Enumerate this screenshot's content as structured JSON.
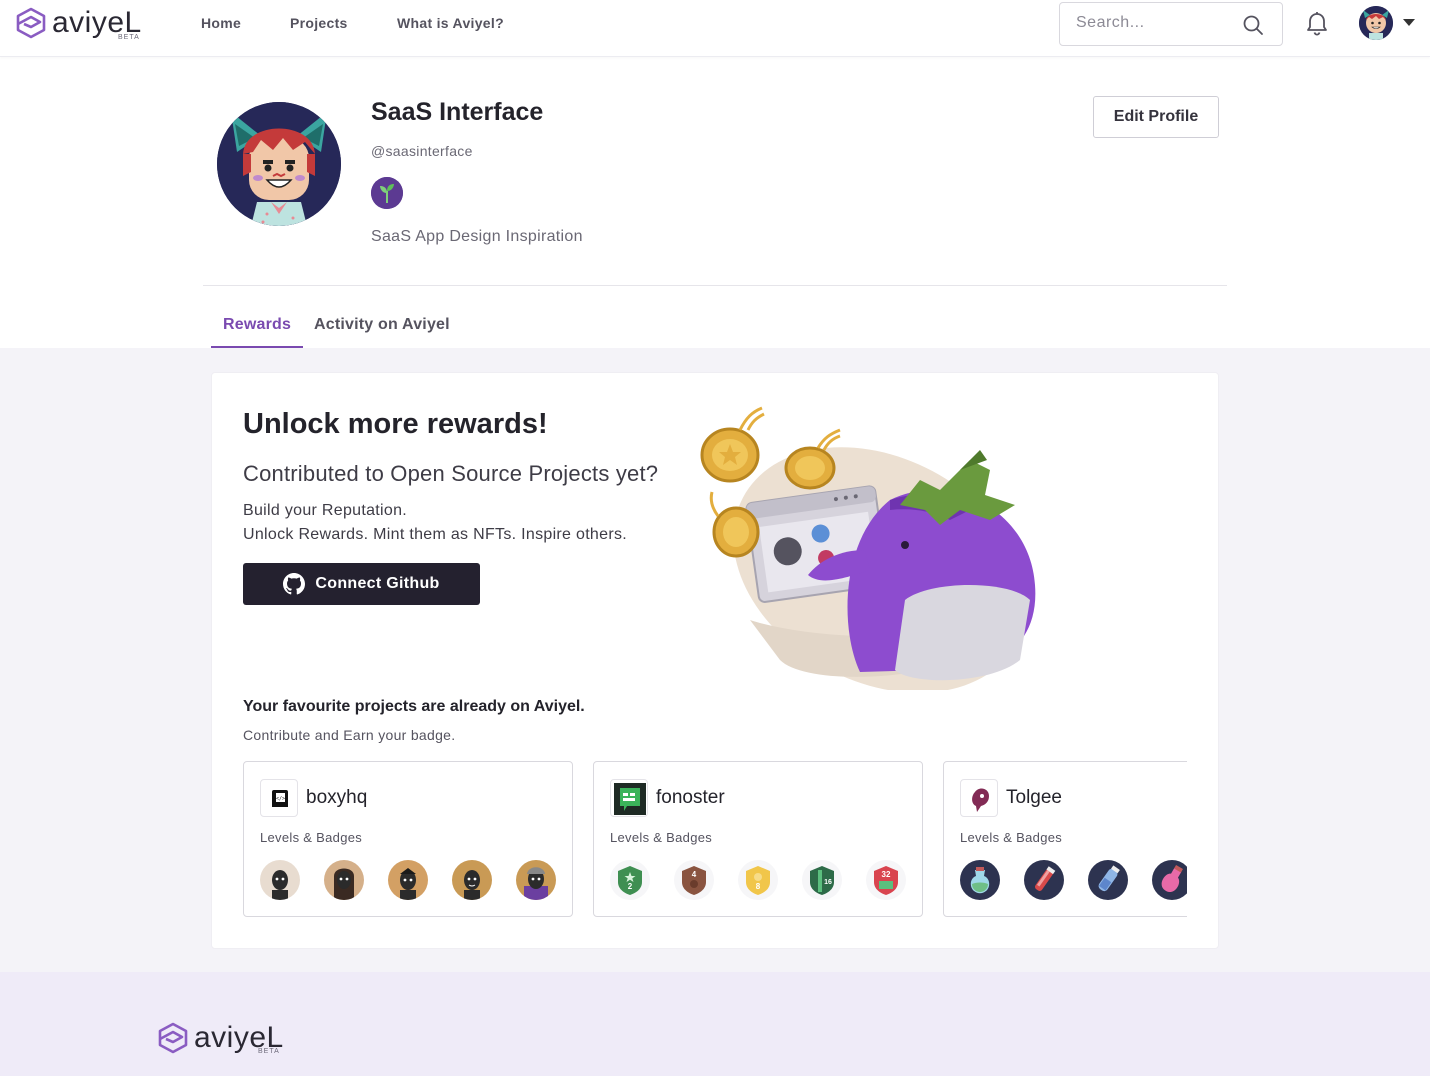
{
  "nav": {
    "logo_word": "aviyeL",
    "logo_beta": "BETA",
    "links": [
      "Home",
      "Projects",
      "What is Aviyel?"
    ],
    "search_placeholder": "Search..."
  },
  "profile": {
    "name": "SaaS Interface",
    "handle": "@saasinterface",
    "bio": "SaaS App Design Inspiration",
    "edit_label": "Edit Profile"
  },
  "tabs": [
    "Rewards",
    "Activity on Aviyel"
  ],
  "rewards": {
    "heading": "Unlock more rewards!",
    "subheading": "Contributed to Open Source Projects yet?",
    "line1": "Build your Reputation.",
    "line2": "Unlock Rewards. Mint them as NFTs. Inspire others.",
    "button_label": "Connect Github"
  },
  "favourites": {
    "title": "Your favourite projects are already on Aviyel.",
    "subtitle": "Contribute and Earn your badge.",
    "projects": [
      {
        "name": "boxyhq",
        "levels_label": "Levels & Badges",
        "badge_colors": [
          "#e8dcd0",
          "#c9a27a",
          "#d3a064",
          "#c99a55",
          "#c99a55"
        ]
      },
      {
        "name": "fonoster",
        "levels_label": "Levels & Badges",
        "badge_badges": [
          "2",
          "4",
          "8",
          "16",
          "32"
        ]
      },
      {
        "name": "Tolgee",
        "levels_label": "Levels & Badges"
      }
    ]
  },
  "footer": {
    "logo_word": "aviyeL",
    "logo_beta": "BETA"
  },
  "colors": {
    "accent": "#7a4ab0",
    "dark_button": "#24212f",
    "content_bg": "#f4f3f8",
    "footer_bg": "#efebf8"
  }
}
